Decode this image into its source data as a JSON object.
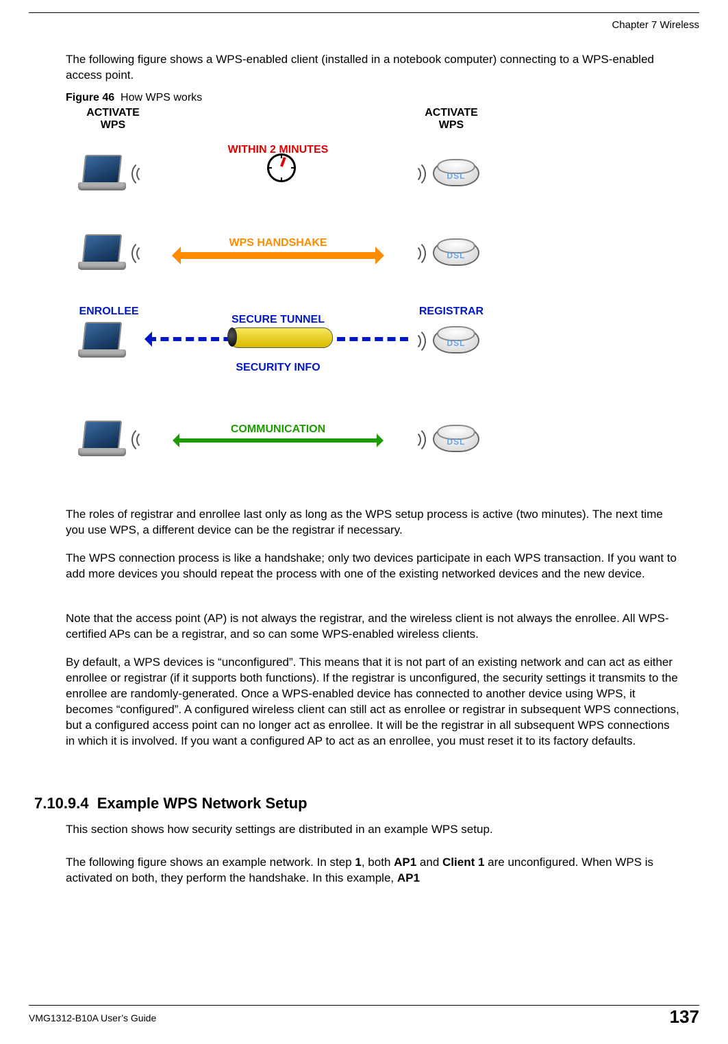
{
  "header": {
    "chapter": "Chapter 7 Wireless"
  },
  "intro": "The following figure shows a WPS-enabled client (installed in a notebook computer) connecting to a WPS-enabled access point.",
  "figure": {
    "caption_label": "Figure 46",
    "caption_title": "How WPS works",
    "labels": {
      "activate_left": "ACTIVATE\nWPS",
      "activate_right": "ACTIVATE\nWPS",
      "within": "WITHIN 2 MINUTES",
      "handshake": "WPS HANDSHAKE",
      "enrollee": "ENROLLEE",
      "registrar": "REGISTRAR",
      "tunnel": "SECURE TUNNEL",
      "secinfo": "SECURITY INFO",
      "comm": "COMMUNICATION"
    },
    "device_text": {
      "dsl": "DSL"
    }
  },
  "paragraphs": {
    "p1": "The roles of registrar and enrollee last only as long as the WPS setup process is active (two minutes). The next time you use WPS, a different device can be the registrar if necessary.",
    "p2": "The WPS connection process is like a handshake; only two devices participate in each WPS transaction. If you want to add more devices you should repeat the process with one of the existing networked devices and the new device.",
    "p3": "Note that the access point (AP) is not always the registrar, and the wireless client is not always the enrollee. All WPS-certified APs can be a registrar, and so can some WPS-enabled wireless clients.",
    "p4": "By default, a WPS devices is “unconfigured”. This means that it is not part of an existing network and can act as either enrollee or registrar (if it supports both functions). If the registrar is unconfigured, the security settings it transmits to the enrollee are randomly-generated. Once a WPS-enabled device has connected to another device using WPS, it becomes “configured”. A configured wireless client can still act as enrollee or registrar in subsequent WPS connections, but a configured access point can no longer act as enrollee. It will be the registrar in all subsequent WPS connections in which it is involved. If you want a configured AP to act as an enrollee, you must reset it to its factory defaults."
  },
  "section": {
    "number": "7.10.9.4",
    "title": "Example WPS Network Setup",
    "p5": "This section shows how security settings are distributed in an example WPS setup.",
    "p6_pre": "The following figure shows an example network. In step ",
    "p6_step": "1",
    "p6_mid1": ", both ",
    "p6_ap1": "AP1",
    "p6_mid2": " and ",
    "p6_client1": "Client 1",
    "p6_mid3": " are unconfigured. When WPS is activated on both, they perform the handshake. In this example, ",
    "p6_ap1b": "AP1"
  },
  "footer": {
    "guide": "VMG1312-B10A User’s Guide",
    "page": "137"
  }
}
